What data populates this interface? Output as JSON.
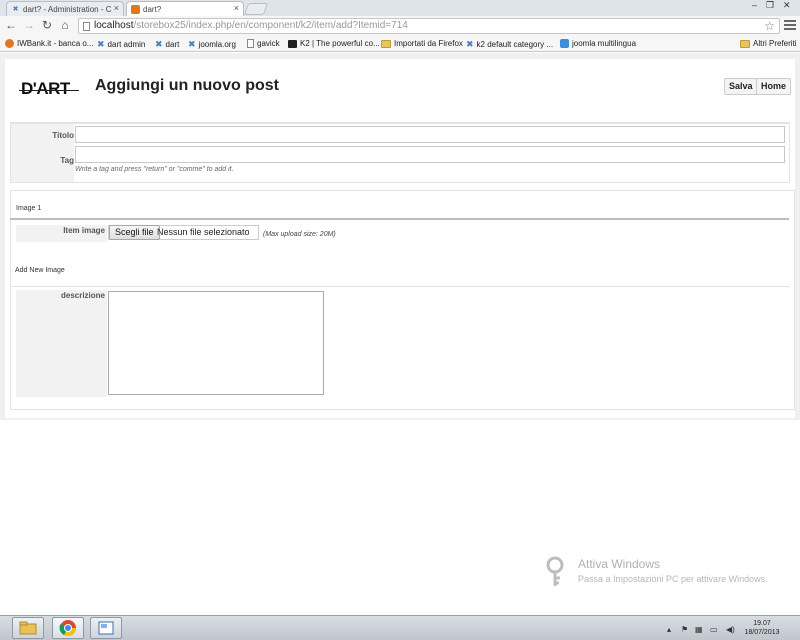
{
  "browser": {
    "tabs": [
      {
        "title": "dart? - Administration - C"
      },
      {
        "title": "dart?"
      }
    ],
    "url": {
      "host": "localhost",
      "path": "/storebox25/index.php/en/component/k2/item/add?Itemid=714"
    },
    "bookmarks": [
      {
        "label": "IWBank.it - banca o...",
        "icon": "iwbank-icon"
      },
      {
        "label": "dart admin",
        "icon": "joomla-icon"
      },
      {
        "label": "dart",
        "icon": "joomla-icon"
      },
      {
        "label": "joomla.org",
        "icon": "joomla-icon"
      },
      {
        "label": "gavick",
        "icon": "page-icon"
      },
      {
        "label": "K2 | The powerful co...",
        "icon": "k2-icon"
      },
      {
        "label": "Importati da Firefox",
        "icon": "folder-icon"
      },
      {
        "label": "k2 default category ...",
        "icon": "joomla-icon"
      },
      {
        "label": "joomla multilingua",
        "icon": "translate-icon"
      },
      {
        "label": "Altri Preferiti",
        "icon": "folder-icon"
      }
    ]
  },
  "page": {
    "logo": "D'ART",
    "title": "Aggiungi un nuovo post",
    "buttons": {
      "save": "Salva",
      "home": "Home"
    },
    "fields": {
      "titolo_label": "Titolo",
      "titolo_value": "",
      "tag_label": "Tag",
      "tag_value": "",
      "tag_hint": "Write a tag and press \"return\" or \"comme\" to add it."
    },
    "image": {
      "section_label": "Image 1",
      "item_image_label": "Item image",
      "choose_file": "Scegli file",
      "no_file": "Nessun file selezionato",
      "max_upload": "(Max upload size: 20M)",
      "add_new": "Add New Image"
    },
    "descrizione_label": "descrizione",
    "descrizione_value": ""
  },
  "watermark": {
    "title": "Attiva Windows",
    "subtitle": "Passa a Impostazioni PC per attivare Windows."
  },
  "taskbar": {
    "time": "19.07",
    "date": "18/07/2013"
  }
}
